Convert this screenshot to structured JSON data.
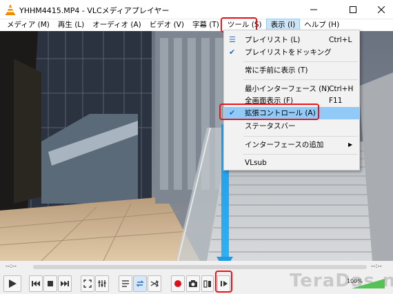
{
  "window": {
    "title": "YHHM4415.MP4 - VLCメディアプレイヤー",
    "icon": "vlc-cone-icon"
  },
  "menubar": {
    "items": [
      {
        "label": "メディア (M)"
      },
      {
        "label": "再生 (L)"
      },
      {
        "label": "オーディオ (A)"
      },
      {
        "label": "ビデオ (V)"
      },
      {
        "label": "字幕 (T)"
      },
      {
        "label": "ツール (S)"
      },
      {
        "label": "表示 (I)"
      },
      {
        "label": "ヘルプ (H)"
      }
    ]
  },
  "view_menu": {
    "items": [
      {
        "label": "プレイリスト (L)",
        "shortcut": "Ctrl+L"
      },
      {
        "label": "プレイリストをドッキング",
        "shortcut": ""
      },
      {
        "label": "常に手前に表示 (T)",
        "shortcut": ""
      },
      {
        "label": "最小インターフェース (N)",
        "shortcut": "Ctrl+H"
      },
      {
        "label": "全画面表示 (F)",
        "shortcut": "F11"
      },
      {
        "label": "拡張コントロール (A)",
        "shortcut": ""
      },
      {
        "label": "ステータスバー",
        "shortcut": ""
      },
      {
        "label": "インターフェースの追加",
        "shortcut": ""
      },
      {
        "label": "VLsub",
        "shortcut": ""
      }
    ],
    "checked_item": "拡張コントロール (A)"
  },
  "seek": {
    "time_elapsed": "--:--",
    "time_total": "--:--"
  },
  "volume": {
    "level_text": "100%"
  },
  "watermark": "TeraDas.net",
  "colors": {
    "highlight_red": "#e8141a",
    "arrow_blue": "#1e9ae6",
    "menu_hover": "#91c9f7"
  }
}
